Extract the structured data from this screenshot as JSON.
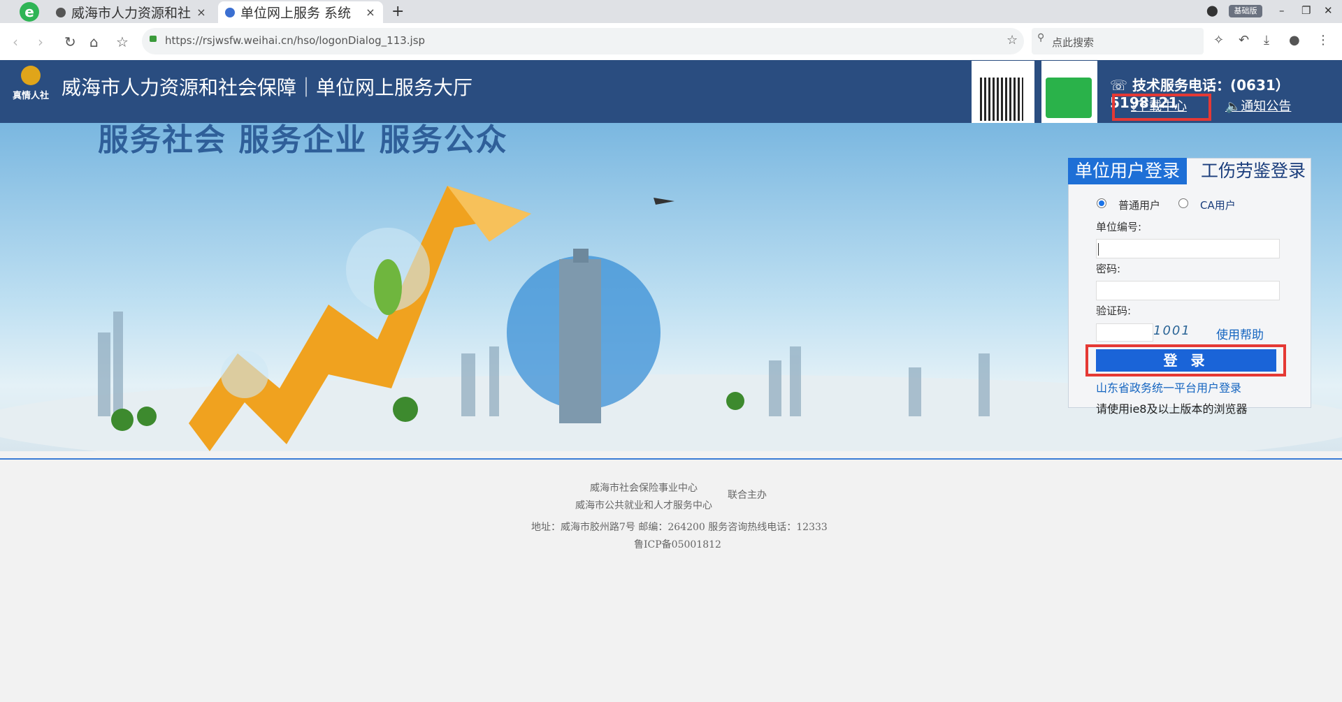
{
  "browser": {
    "logo": "e",
    "tabs": [
      {
        "title": "威海市人力资源和社",
        "close": "×"
      },
      {
        "title": "单位网上服务 系统",
        "close": "×"
      }
    ],
    "new_tab": "+",
    "badge": "基础版",
    "url": "https://rsjwsfw.weihai.cn/hso/logonDialog_113.jsp",
    "search_placeholder": "点此搜索"
  },
  "header": {
    "logo_text": "真情人社",
    "title": "威海市人力资源和社会保障｜单位网上服务大厅",
    "phone_label": "技术服务电话：(0631）5198121",
    "download": "下载中心",
    "notice": "通知公告"
  },
  "banner": {
    "slogan": "服务社会  服务企业  服务公众"
  },
  "login": {
    "tab_unit": "单位用户登录",
    "tab_injury": "工伤劳鉴登录",
    "radio_normal": "普通用户",
    "radio_ca": "CA用户",
    "label_unit_no": "单位编号:",
    "label_password": "密码:",
    "label_captcha": "验证码:",
    "captcha_text": "1001",
    "help": "使用帮助",
    "login_button": "登 录",
    "province_link": "山东省政务统一平台用户登录",
    "browser_tip": "请使用ie8及以上版本的浏览器"
  },
  "footer": {
    "org1": "威海市社会保险事业中心",
    "org2": "威海市公共就业和人才服务中心",
    "joint": "联合主办",
    "address": "地址：威海市胶州路7号 邮编：264200 服务咨询热线电话：12333",
    "icp": "鲁ICP备05001812"
  }
}
